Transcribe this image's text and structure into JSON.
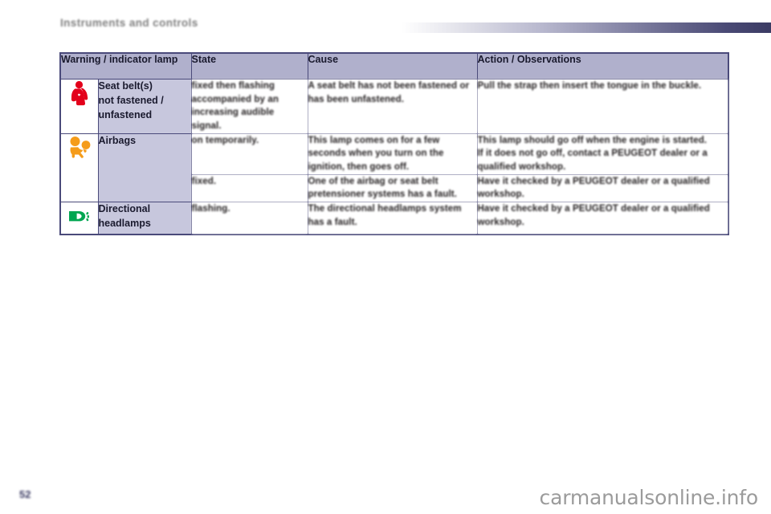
{
  "chapter": {
    "title": "Instruments and controls"
  },
  "table": {
    "headers": [
      "Warning / indicator lamp",
      "State",
      "Cause",
      "Action / Observations"
    ],
    "rows": [
      {
        "icon_name": "seat-belt-warning-icon",
        "icon_color": "#e3001b",
        "lamp": "Seat belt(s)\nnot fastened /\nunfastened",
        "lamp_lines": [
          "Seat belt(s)",
          "not fastened /",
          "unfastened"
        ],
        "state_lines": [
          "fixed then flashing",
          "accompanied by an",
          "increasing audible",
          "signal."
        ],
        "cause_lines": [
          "A seat belt has not been fastened or",
          "has been unfastened."
        ],
        "action_lines": [
          "Pull the strap then insert the tongue in the buckle."
        ]
      },
      {
        "icon_name": "airbag-warning-icon",
        "icon_color": "#f59c1a",
        "lamp_lines": [
          "Airbags"
        ],
        "state_lines": [
          "on temporarily."
        ],
        "cause_lines": [
          "This lamp comes on for a few",
          "seconds when you turn on the",
          "ignition, then goes off."
        ],
        "action_lines": [
          "This lamp should go off when the engine is started.",
          "If it does not go off, contact a PEUGEOT dealer or a",
          "qualified workshop."
        ]
      },
      {
        "icon_name": "airbag-warning-icon",
        "icon_color": "#f59c1a",
        "lamp_lines": [],
        "state_lines": [
          "fixed."
        ],
        "cause_lines": [
          "One of the airbag or seat belt",
          "pretensioner systems has a fault."
        ],
        "action_lines": [
          "Have it checked by a PEUGEOT dealer or a qualified",
          "workshop."
        ]
      },
      {
        "icon_name": "directional-headlamps-icon",
        "icon_color": "#00a651",
        "lamp_lines": [
          "Directional",
          "headlamps"
        ],
        "state_lines": [
          "flashing."
        ],
        "cause_lines": [
          "The directional headlamps system",
          "has a fault."
        ],
        "action_lines": [
          "Have it checked by a PEUGEOT dealer or a qualified",
          "workshop."
        ]
      }
    ]
  },
  "footer": {
    "page_number": "52",
    "watermark": "carmanualsonline.info"
  }
}
